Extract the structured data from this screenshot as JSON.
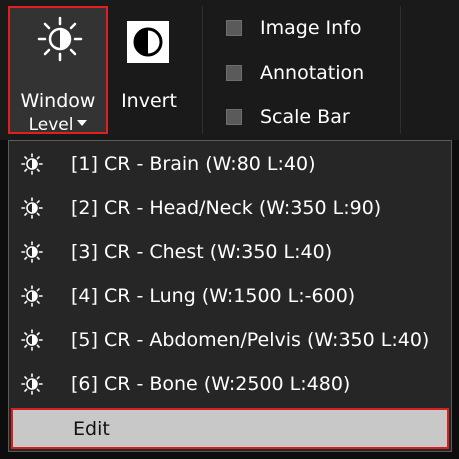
{
  "toolbar": {
    "window_level": {
      "label_line1": "Window",
      "label_line2": "Level",
      "icon": "window-level-icon"
    },
    "invert": {
      "label": "Invert",
      "icon": "invert-icon"
    },
    "toggles": [
      {
        "label": "Image Info",
        "checked": false
      },
      {
        "label": "Annotation",
        "checked": false
      },
      {
        "label": "Scale Bar",
        "checked": false
      }
    ]
  },
  "menu": {
    "items": [
      {
        "label": "[1] CR - Brain (W:80 L:40)"
      },
      {
        "label": "[2] CR - Head/Neck (W:350 L:90)"
      },
      {
        "label": "[3] CR - Chest (W:350 L:40)"
      },
      {
        "label": "[4] CR - Lung (W:1500 L:-600)"
      },
      {
        "label": "[5] CR - Abdomen/Pelvis (W:350 L:40)"
      },
      {
        "label": "[6] CR - Bone (W:2500 L:480)"
      }
    ],
    "edit_label": "Edit"
  },
  "colors": {
    "highlight_border": "#e02020",
    "menu_background": "#262626",
    "edit_background": "#c8c8c8"
  }
}
